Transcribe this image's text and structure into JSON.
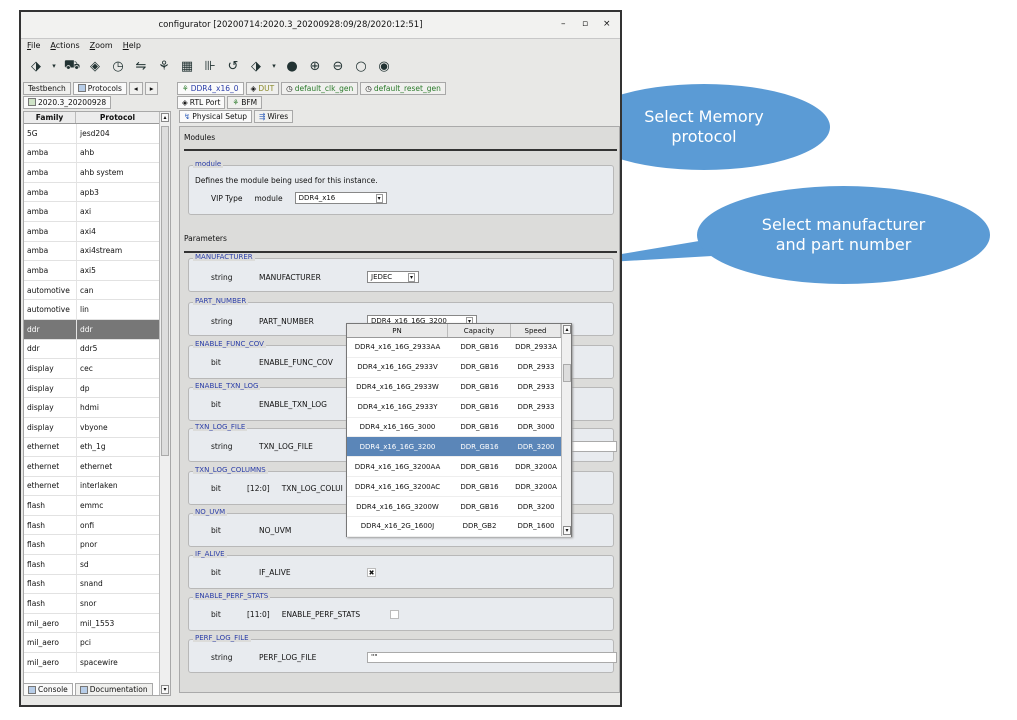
{
  "window": {
    "title": "configurator [20200714:2020.3_20200928:09/28/2020:12:51]",
    "min": "–",
    "max": "▫",
    "close": "×"
  },
  "menu": [
    "File",
    "Actions",
    "Zoom",
    "Help"
  ],
  "left_tabs": [
    "Testbench",
    "Protocols"
  ],
  "left_version": "2020.3_20200928",
  "protocol_table": {
    "headers": [
      "Family",
      "Protocol"
    ],
    "rows": [
      [
        "5G",
        "jesd204"
      ],
      [
        "amba",
        "ahb"
      ],
      [
        "amba",
        "ahb system"
      ],
      [
        "amba",
        "apb3"
      ],
      [
        "amba",
        "axi"
      ],
      [
        "amba",
        "axi4"
      ],
      [
        "amba",
        "axi4stream"
      ],
      [
        "amba",
        "axi5"
      ],
      [
        "automotive",
        "can"
      ],
      [
        "automotive",
        "lin"
      ],
      [
        "ddr",
        "ddr"
      ],
      [
        "ddr",
        "ddr5"
      ],
      [
        "display",
        "cec"
      ],
      [
        "display",
        "dp"
      ],
      [
        "display",
        "hdmi"
      ],
      [
        "display",
        "vbyone"
      ],
      [
        "ethernet",
        "eth_1g"
      ],
      [
        "ethernet",
        "ethernet"
      ],
      [
        "ethernet",
        "interlaken"
      ],
      [
        "flash",
        "emmc"
      ],
      [
        "flash",
        "onfi"
      ],
      [
        "flash",
        "pnor"
      ],
      [
        "flash",
        "sd"
      ],
      [
        "flash",
        "snand"
      ],
      [
        "flash",
        "snor"
      ],
      [
        "mil_aero",
        "mil_1553"
      ],
      [
        "mil_aero",
        "pci"
      ],
      [
        "mil_aero",
        "spacewire"
      ]
    ],
    "selected_index": 10
  },
  "bottom_tabs": [
    "Console",
    "Documentation"
  ],
  "editor_tabs": [
    "DDR4_x16_0",
    "DUT",
    "default_clk_gen",
    "default_reset_gen"
  ],
  "sub_tabs": [
    "RTL Port",
    "BFM"
  ],
  "sub_sub_tabs": [
    "Physical Setup",
    "Wires"
  ],
  "modules_header": "Modules",
  "module_group": {
    "label": "module",
    "desc": "Defines the module being used for this instance.",
    "type": "VIP Type",
    "name": "module",
    "value": "DDR4_x16"
  },
  "parameters_header": "Parameters",
  "params": [
    {
      "label": "MANUFACTURER",
      "type": "string",
      "range": "",
      "name": "MANUFACTURER",
      "value": "JEDEC"
    },
    {
      "label": "PART_NUMBER",
      "type": "string",
      "range": "",
      "name": "PART_NUMBER",
      "value": "DDR4_x16_16G_3200"
    },
    {
      "label": "ENABLE_FUNC_COV",
      "type": "bit",
      "range": "",
      "name": "ENABLE_FUNC_COV",
      "value": ""
    },
    {
      "label": "ENABLE_TXN_LOG",
      "type": "bit",
      "range": "",
      "name": "ENABLE_TXN_LOG",
      "value": ""
    },
    {
      "label": "TXN_LOG_FILE",
      "type": "string",
      "range": "",
      "name": "TXN_LOG_FILE",
      "value": ""
    },
    {
      "label": "TXN_LOG_COLUMNS",
      "type": "bit",
      "range": "[12:0]",
      "name": "TXN_LOG_COLUI",
      "value": ""
    },
    {
      "label": "NO_UVM",
      "type": "bit",
      "range": "",
      "name": "NO_UVM",
      "value": ""
    },
    {
      "label": "IF_ALIVE",
      "type": "bit",
      "range": "",
      "name": "IF_ALIVE",
      "value": "✖"
    },
    {
      "label": "ENABLE_PERF_STATS",
      "type": "bit",
      "range": "[11:0]",
      "name": "ENABLE_PERF_STATS",
      "value": ""
    },
    {
      "label": "PERF_LOG_FILE",
      "type": "string",
      "range": "",
      "name": "PERF_LOG_FILE",
      "value": "\"\""
    }
  ],
  "dropdown": {
    "headers": [
      "PN",
      "Capacity",
      "Speed"
    ],
    "rows": [
      [
        "DDR4_x16_16G_2933AA",
        "DDR_GB16",
        "DDR_2933A"
      ],
      [
        "DDR4_x16_16G_2933V",
        "DDR_GB16",
        "DDR_2933"
      ],
      [
        "DDR4_x16_16G_2933W",
        "DDR_GB16",
        "DDR_2933"
      ],
      [
        "DDR4_x16_16G_2933Y",
        "DDR_GB16",
        "DDR_2933"
      ],
      [
        "DDR4_x16_16G_3000",
        "DDR_GB16",
        "DDR_3000"
      ],
      [
        "DDR4_x16_16G_3200",
        "DDR_GB16",
        "DDR_3200"
      ],
      [
        "DDR4_x16_16G_3200AA",
        "DDR_GB16",
        "DDR_3200A"
      ],
      [
        "DDR4_x16_16G_3200AC",
        "DDR_GB16",
        "DDR_3200A"
      ],
      [
        "DDR4_x16_16G_3200W",
        "DDR_GB16",
        "DDR_3200"
      ],
      [
        "DDR4_x16_2G_1600J",
        "DDR_GB2",
        "DDR_1600"
      ]
    ],
    "selected_index": 5
  },
  "callouts": [
    "Select Memory protocol",
    "Select manufacturer and part number"
  ],
  "colors": {
    "accent_blue": "#5b9bd5",
    "selection_grey": "#777777",
    "group_label": "#2a3da8"
  }
}
